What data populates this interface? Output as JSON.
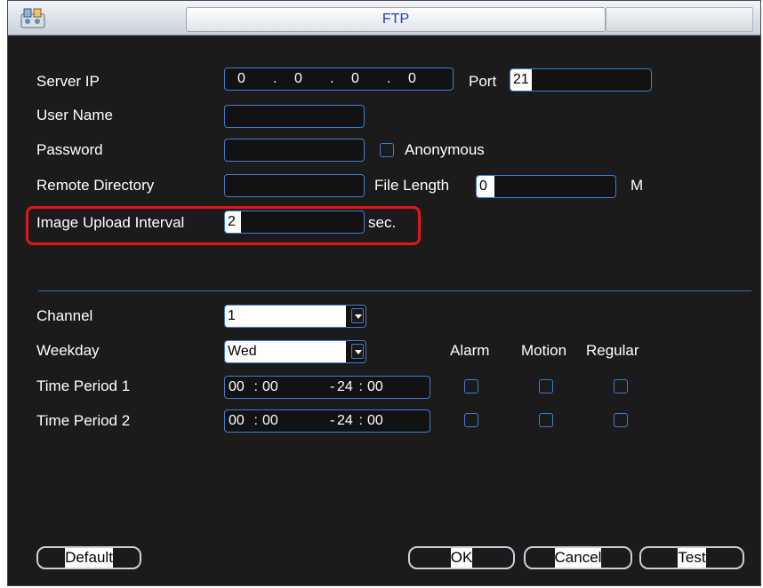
{
  "window": {
    "title": "FTP"
  },
  "server": {
    "server_ip_label": "Server IP",
    "ip": [
      "0",
      "0",
      "0",
      "0"
    ],
    "port_label": "Port",
    "port": "21",
    "user_name_label": "User Name",
    "user_name": "",
    "password_label": "Password",
    "password": "",
    "anonymous_label": "Anonymous",
    "remote_dir_label": "Remote Directory",
    "remote_dir": "",
    "file_length_label": "File Length",
    "file_length": "0",
    "file_length_unit": "M",
    "upload_interval_label": "Image Upload Interval",
    "upload_interval": "2",
    "upload_interval_unit": "sec."
  },
  "schedule": {
    "channel_label": "Channel",
    "channel": "1",
    "weekday_label": "Weekday",
    "weekday": "Wed",
    "col_alarm": "Alarm",
    "col_motion": "Motion",
    "col_regular": "Regular",
    "periods": [
      {
        "label": "Time Period 1",
        "start_h": "00",
        "start_m": "00",
        "end_h": "24",
        "end_m": "00"
      },
      {
        "label": "Time Period 2",
        "start_h": "00",
        "start_m": "00",
        "end_h": "24",
        "end_m": "00"
      }
    ]
  },
  "buttons": {
    "default": "Default",
    "ok": "OK",
    "cancel": "Cancel",
    "test": "Test"
  },
  "colors": {
    "accent": "#3f7fd0",
    "highlight": "#e0161c",
    "background": "#1b1b1b",
    "title": "#1a3dbd"
  }
}
